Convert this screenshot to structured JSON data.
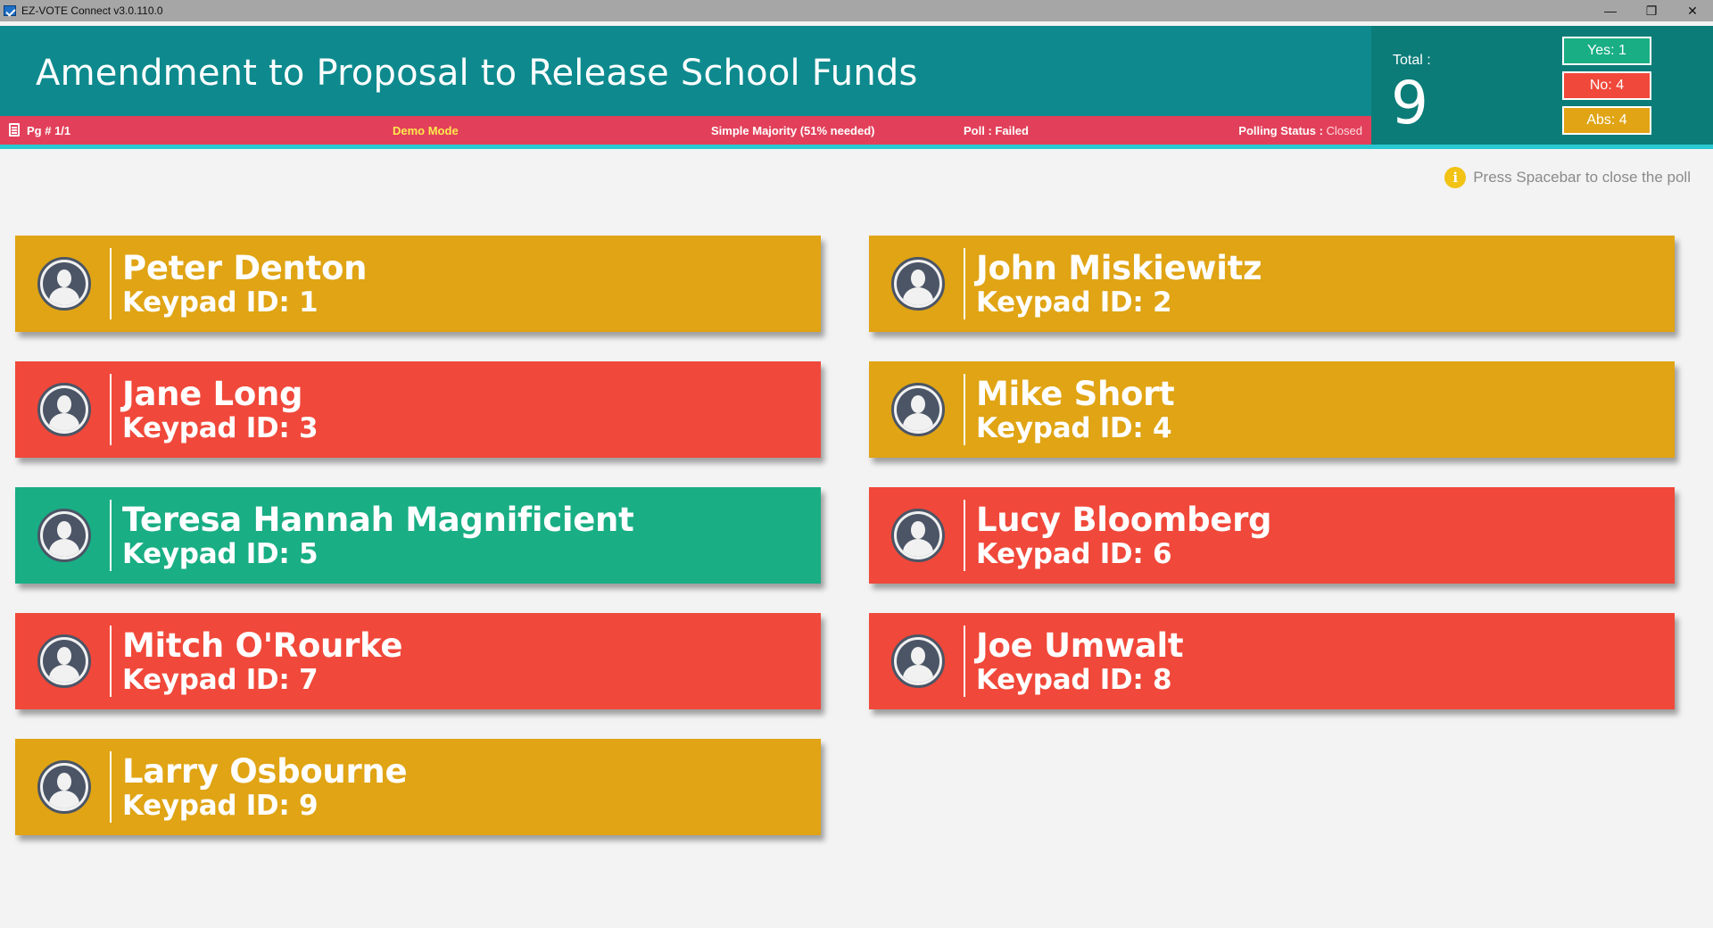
{
  "window": {
    "title": "EZ-VOTE Connect v3.0.110.0",
    "minimize_glyph": "—",
    "restore_glyph": "❐",
    "close_glyph": "✕"
  },
  "header": {
    "title": "Amendment to Proposal to Release School Funds"
  },
  "status": {
    "page": "Pg # 1/1",
    "mode": "Demo Mode",
    "majority": "Simple Majority (51% needed)",
    "poll_label": "Poll : ",
    "poll_value": "Failed",
    "polling_label": "Polling Status : ",
    "polling_value": "Closed"
  },
  "totals": {
    "label": "Total :",
    "value": "9",
    "yes": "Yes: 1",
    "no": "No: 4",
    "abs": "Abs: 4"
  },
  "hint": {
    "icon_glyph": "i",
    "text": "Press Spacebar to close the poll"
  },
  "colors": {
    "header": "#0e8a8e",
    "status_bar": "#e2405a",
    "yes": "#19ae84",
    "no": "#f0483a",
    "abs": "#e0a414",
    "accent": "#28c9d0"
  },
  "members": [
    {
      "name": "Peter Denton",
      "keypad": "Keypad ID: 1",
      "vote": "abs"
    },
    {
      "name": "John Miskiewitz",
      "keypad": "Keypad ID: 2",
      "vote": "abs"
    },
    {
      "name": "Jane Long",
      "keypad": "Keypad ID: 3",
      "vote": "no"
    },
    {
      "name": "Mike Short",
      "keypad": "Keypad ID: 4",
      "vote": "abs"
    },
    {
      "name": "Teresa Hannah Magnificient",
      "keypad": "Keypad ID: 5",
      "vote": "yes"
    },
    {
      "name": "Lucy Bloomberg",
      "keypad": "Keypad ID: 6",
      "vote": "no"
    },
    {
      "name": "Mitch O'Rourke",
      "keypad": "Keypad ID: 7",
      "vote": "no"
    },
    {
      "name": "Joe Umwalt",
      "keypad": "Keypad ID: 8",
      "vote": "no"
    },
    {
      "name": "Larry Osbourne",
      "keypad": "Keypad ID: 9",
      "vote": "abs"
    }
  ]
}
